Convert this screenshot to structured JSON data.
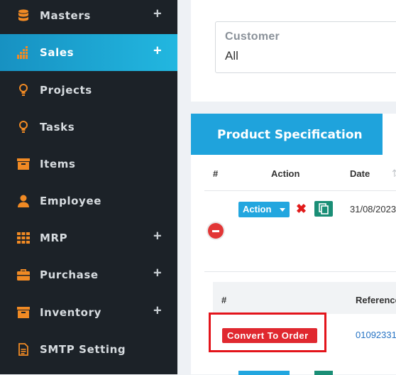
{
  "sidebar": {
    "items": [
      {
        "label": "Masters",
        "icon": "database-icon",
        "has_plus": true
      },
      {
        "label": "Sales",
        "icon": "bar-chart-icon",
        "has_plus": true,
        "active": true
      },
      {
        "label": "Projects",
        "icon": "lightbulb-icon",
        "has_plus": false
      },
      {
        "label": "Tasks",
        "icon": "lightbulb-icon",
        "has_plus": false
      },
      {
        "label": "Items",
        "icon": "archive-box-icon",
        "has_plus": false
      },
      {
        "label": "Employee",
        "icon": "user-icon",
        "has_plus": false
      },
      {
        "label": "MRP",
        "icon": "grid-icon",
        "has_plus": true
      },
      {
        "label": "Purchase",
        "icon": "briefcase-icon",
        "has_plus": true
      },
      {
        "label": "Inventory",
        "icon": "archive-box-icon",
        "has_plus": true
      },
      {
        "label": "SMTP Setting",
        "icon": "document-icon",
        "has_plus": false
      }
    ],
    "plus_symbol": "+",
    "icon_color": "#f08a24",
    "active_color": "#22b7e0"
  },
  "customer": {
    "label": "Customer",
    "value": "All"
  },
  "spec": {
    "tab_label": "Product Specification",
    "columns": {
      "hash": "#",
      "action": "Action",
      "date": "Date"
    },
    "row": {
      "action_button": "Action",
      "date": "31/08/2023"
    },
    "sub_table": {
      "columns": {
        "hash": "#",
        "reference": "Reference"
      },
      "convert_button": "Convert To Order",
      "reference_value": "01092331"
    }
  },
  "colors": {
    "primary": "#1fa3dc",
    "danger": "#e0282f",
    "success": "#1a8e76",
    "highlight_frame": "#e3141b"
  }
}
